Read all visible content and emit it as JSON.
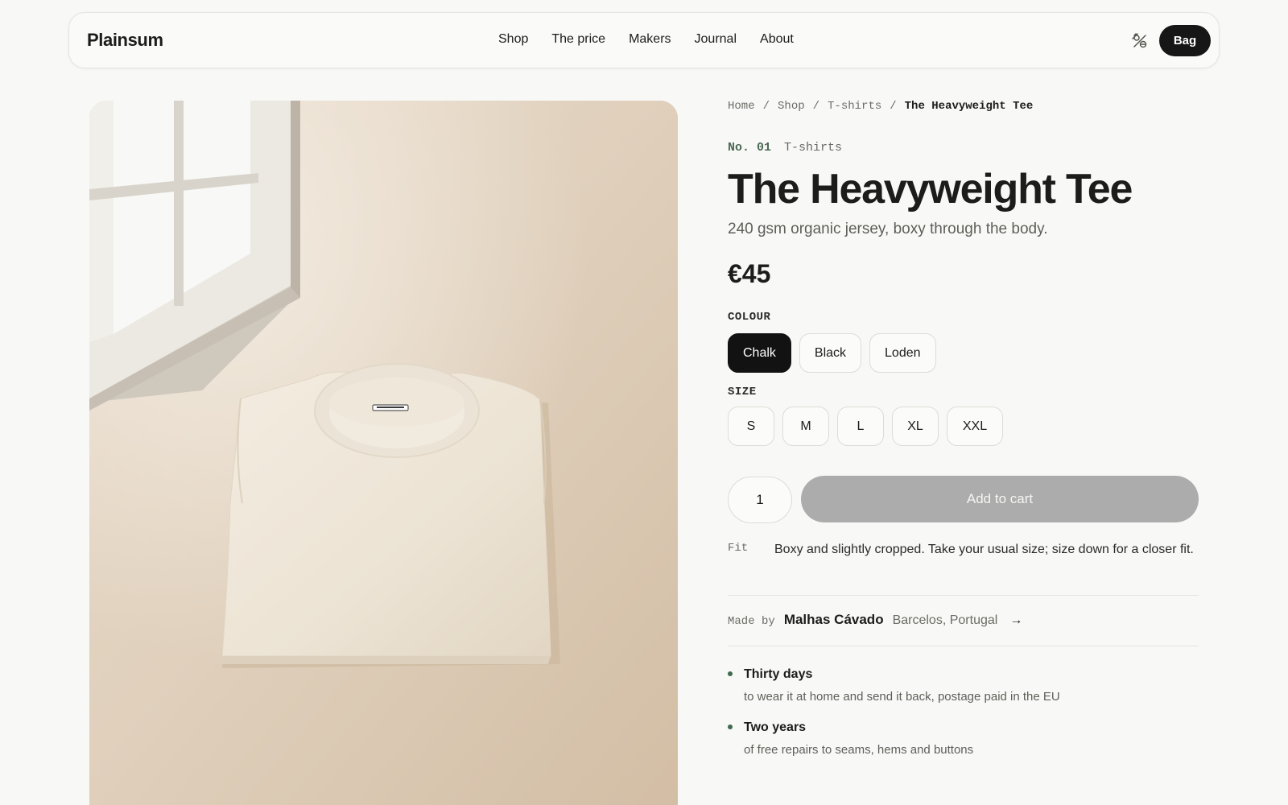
{
  "header": {
    "logo": "Plainsum",
    "nav": [
      "Shop",
      "The price",
      "Makers",
      "Journal",
      "About"
    ],
    "bag_label": "Bag",
    "theme_icon": "theme-toggle-icon"
  },
  "breadcrumb": {
    "items": [
      "Home",
      "Shop",
      "T-shirts"
    ],
    "separator": "/",
    "current": "The Heavyweight Tee"
  },
  "product": {
    "number": "No. 01",
    "category": "T-shirts",
    "title": "The Heavyweight Tee",
    "subtitle": "240 gsm organic jersey, boxy through the body.",
    "price": "€45",
    "colour_label": "COLOUR",
    "colours": [
      "Chalk",
      "Black",
      "Loden"
    ],
    "selected_colour": "Chalk",
    "size_label": "SIZE",
    "sizes": [
      "S",
      "M",
      "L",
      "XL",
      "XXL"
    ],
    "quantity": "1",
    "add_to_cart": "Add to cart",
    "fit_label": "Fit",
    "fit_text": "Boxy and slightly cropped. Take your usual size; size down for a closer fit.",
    "maker": {
      "label": "Made by",
      "name": "Malhas Cávado",
      "location": "Barcelos, Portugal",
      "arrow": "→"
    },
    "perks": [
      {
        "title": "Thirty days",
        "desc": "to wear it at home and send it back, postage paid in the EU"
      },
      {
        "title": "Two years",
        "desc": "of free repairs to seams, hems and buttons"
      }
    ]
  },
  "colors": {
    "background": "#f8f8f6",
    "primary_button": "#121212",
    "disabled_cta": "#acacac",
    "accent_green": "#3f6a4e"
  }
}
